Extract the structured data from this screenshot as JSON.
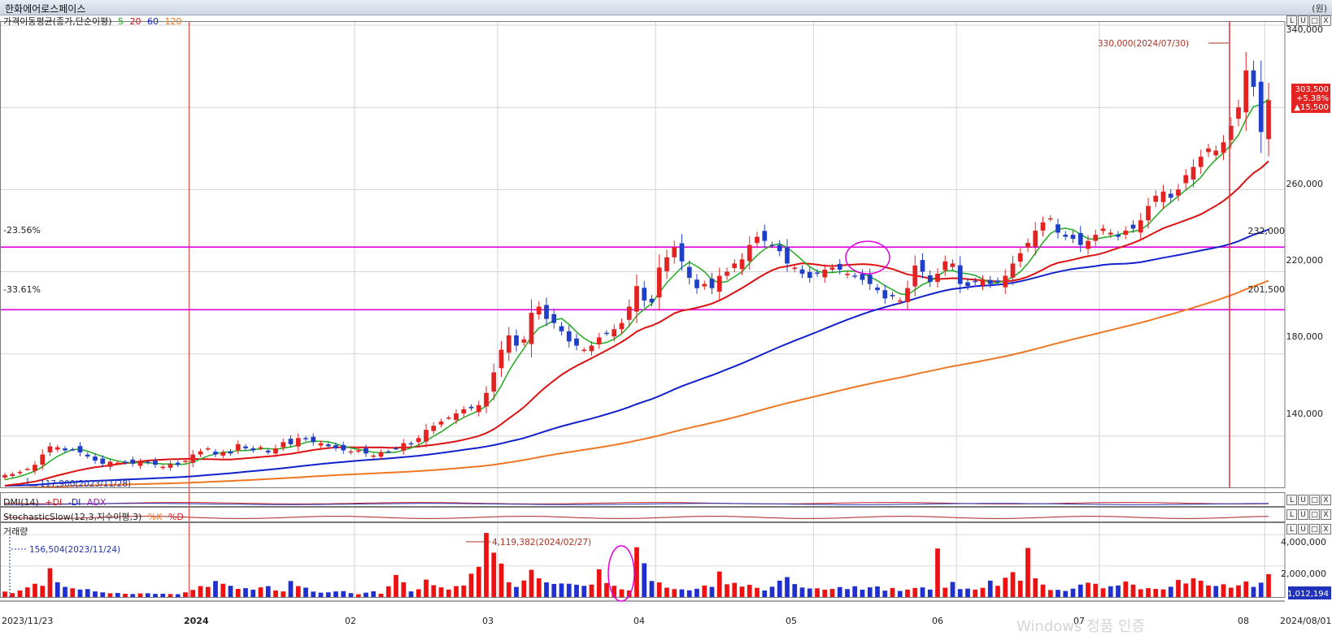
{
  "window": {
    "title": "한화에어로스페이스",
    "unit": "(원)"
  },
  "price_panel": {
    "legend_label": "가격이동평균(종가,단순이평)",
    "ma_periods": [
      "5",
      "20",
      "60",
      "120"
    ],
    "ma_colors": {
      "5": "#22aa22",
      "20": "#dd1111",
      "60": "#1122cc",
      "120": "#ee7722"
    },
    "y_ticks": [
      "340,000",
      "260,000",
      "220,000",
      "180,000",
      "140,000"
    ],
    "y_tick_values": [
      340000,
      300000,
      260000,
      220000,
      180000,
      140000
    ],
    "high_annotation": "330,000(2024/07/30)",
    "low_annotation": "117,900(2023/11/28)",
    "current_price": "303,500",
    "current_change_pct": "+5.38%",
    "current_change": "▲15,500",
    "hline_upper": {
      "label_left": "-23.56%",
      "label_right": "232,000",
      "value": 232000
    },
    "hline_lower": {
      "label_left": "-33.61%",
      "label_right": "201,500",
      "value": 201500
    },
    "highlight_color": "#e000e0"
  },
  "dmi_panel": {
    "label": "DMI(14)",
    "series": [
      "+DI",
      "-DI",
      "ADX"
    ]
  },
  "stoch_panel": {
    "label": "StochasticSlow(12,3,지수이평,3)",
    "series": [
      "%K",
      "%D"
    ]
  },
  "volume_panel": {
    "label": "거래량",
    "y_ticks": [
      "4,000,000",
      "2,000,000"
    ],
    "y_tick_values": [
      4000000,
      2000000
    ],
    "current": "1,012,194",
    "low_annotation": "156,504(2023/11/24)",
    "high_annotation": "4,119,382(2024/02/27)"
  },
  "x_axis": {
    "labels": [
      "2023/11/23",
      "2024",
      "02",
      "03",
      "04",
      "05",
      "06",
      "07",
      "08",
      "2024/08/01"
    ]
  },
  "watermark": "Windows 정품 인증",
  "ctl_glyphs": [
    "L",
    "U",
    "□",
    "X"
  ],
  "chart_data": {
    "type": "candlestick",
    "price_range": [
      115000,
      342000
    ],
    "volume_range": [
      0,
      4700000
    ],
    "month_boundaries": [
      {
        "label": "2024",
        "index": 25
      },
      {
        "label": "02",
        "index": 47
      },
      {
        "label": "03",
        "index": 66
      },
      {
        "label": "04",
        "index": 87
      },
      {
        "label": "05",
        "index": 108
      },
      {
        "label": "06",
        "index": 127
      },
      {
        "label": "07",
        "index": 146
      },
      {
        "label": "08",
        "index": 168
      }
    ],
    "closes": [
      121000,
      121500,
      122500,
      124000,
      126000,
      131000,
      135000,
      134500,
      133000,
      133500,
      132000,
      130000,
      128000,
      126500,
      127500,
      127000,
      127000,
      126500,
      127500,
      127000,
      126000,
      125000,
      126500,
      126000,
      128000,
      131000,
      132500,
      134000,
      131000,
      132000,
      131500,
      136000,
      134000,
      133000,
      134500,
      132000,
      134000,
      137000,
      136000,
      139000,
      138500,
      137000,
      136500,
      135000,
      134000,
      133000,
      132500,
      133000,
      131500,
      130500,
      132000,
      132500,
      134000,
      136500,
      136000,
      139000,
      143000,
      145000,
      147000,
      149000,
      151000,
      153000,
      153500,
      155000,
      161000,
      171000,
      182000,
      189000,
      184000,
      187000,
      200000,
      203000,
      197000,
      195000,
      191000,
      186000,
      184000,
      182000,
      184000,
      188000,
      190000,
      192000,
      195000,
      203000,
      213000,
      206000,
      205000,
      222000,
      227000,
      232000,
      225000,
      217000,
      212000,
      214000,
      212000,
      218000,
      220000,
      224000,
      226000,
      233000,
      237000,
      235000,
      233000,
      230000,
      224000,
      222000,
      219000,
      217000,
      219000,
      221000,
      222000,
      221000,
      219000,
      218000,
      216000,
      214000,
      211000,
      207000,
      208000,
      206000,
      212000,
      223000,
      220000,
      215000,
      219000,
      225000,
      224000,
      214000,
      213000,
      215000,
      216000,
      214000,
      215000,
      218000,
      224000,
      229000,
      234000,
      240000,
      244000,
      246000,
      239000,
      237000,
      236000,
      233000,
      235000,
      238000,
      241000,
      239000,
      237000,
      240000,
      241000,
      245000,
      252000,
      257000,
      259000,
      256000,
      260000,
      267000,
      271000,
      276000,
      280000,
      279000,
      283000,
      291000,
      300000,
      318000,
      310000,
      288000,
      303500
    ],
    "volumes": [
      350000,
      250000,
      420000,
      620000,
      850000,
      720000,
      1850000,
      950000,
      650000,
      560000,
      480000,
      510000,
      360000,
      300000,
      240000,
      260000,
      210000,
      190000,
      230000,
      240000,
      200000,
      210000,
      190000,
      180000,
      300000,
      460000,
      700000,
      650000,
      1030000,
      850000,
      720000,
      520000,
      570000,
      470000,
      620000,
      700000,
      420000,
      360000,
      1030000,
      700000,
      600000,
      350000,
      280000,
      300000,
      360000,
      380000,
      250000,
      180000,
      280000,
      370000,
      210000,
      690000,
      1420000,
      950000,
      360000,
      500000,
      1120000,
      760000,
      620000,
      480000,
      700000,
      740000,
      1500000,
      1940000,
      4120000,
      2850000,
      2150000,
      950000,
      650000,
      1060000,
      1750000,
      1200000,
      940000,
      840000,
      870000,
      850000,
      790000,
      720000,
      800000,
      1780000,
      900000,
      720000,
      490000,
      420000,
      3200000,
      2170000,
      1030000,
      940000,
      600000,
      510000,
      490000,
      430000,
      530000,
      740000,
      650000,
      1640000,
      820000,
      910000,
      670000,
      790000,
      590000,
      420000,
      660000,
      1050000,
      1280000,
      830000,
      610000,
      550000,
      560000,
      470000,
      520000,
      640000,
      510000,
      690000,
      470000,
      620000,
      680000,
      410000,
      580000,
      390000,
      480000,
      580000,
      620000,
      480000,
      3120000,
      600000,
      970000,
      510000,
      540000,
      480000,
      590000,
      1050000,
      720000,
      1240000,
      1600000,
      1050000,
      3150000,
      1200000,
      800000,
      450000,
      460000,
      390000,
      540000,
      800000,
      920000,
      850000,
      560000,
      690000,
      740000,
      1000000,
      800000,
      500000,
      570000,
      520000,
      490000,
      660000,
      1100000,
      870000,
      1200000,
      1050000,
      740000,
      710000,
      820000,
      600000,
      750000,
      1000000,
      650000,
      920000,
      1470000,
      1012194
    ]
  }
}
